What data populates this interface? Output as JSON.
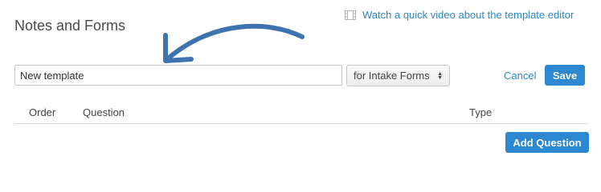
{
  "header": {
    "title": "Notes and Forms",
    "video_link": "Watch a quick video about the template editor",
    "video_icon": "film-icon"
  },
  "form": {
    "name_value": "New template",
    "type_select": "for Intake Forms",
    "cancel_label": "Cancel",
    "save_label": "Save"
  },
  "table": {
    "columns": [
      "Order",
      "Question",
      "Type"
    ]
  },
  "actions": {
    "add_question_label": "Add Question"
  },
  "colors": {
    "accent": "#2b88d1",
    "link": "#2d86c7",
    "arrow": "#3f73b0"
  }
}
